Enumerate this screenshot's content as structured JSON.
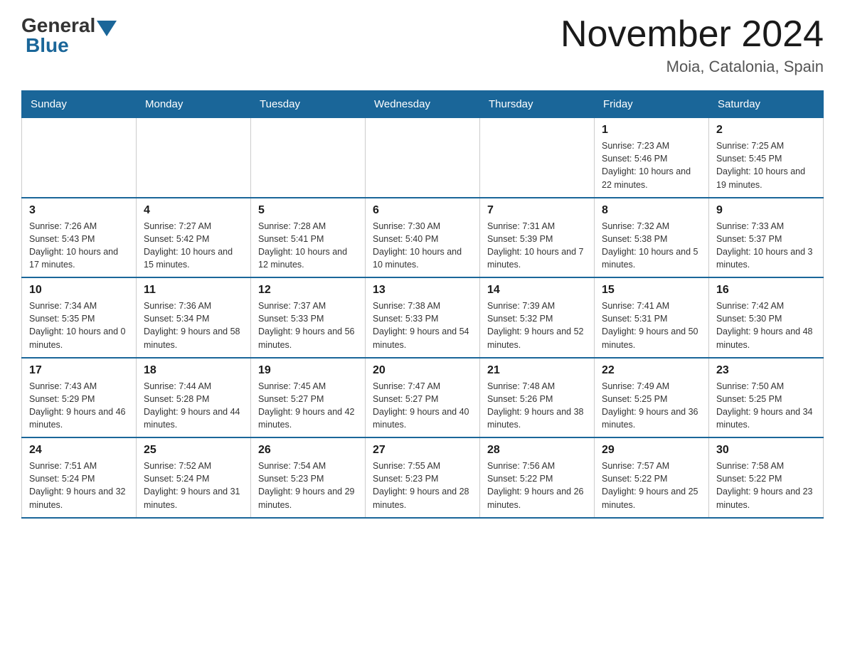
{
  "header": {
    "logo_general": "General",
    "logo_blue": "Blue",
    "month_title": "November 2024",
    "location": "Moia, Catalonia, Spain"
  },
  "days_of_week": [
    "Sunday",
    "Monday",
    "Tuesday",
    "Wednesday",
    "Thursday",
    "Friday",
    "Saturday"
  ],
  "weeks": [
    [
      {
        "day": "",
        "info": ""
      },
      {
        "day": "",
        "info": ""
      },
      {
        "day": "",
        "info": ""
      },
      {
        "day": "",
        "info": ""
      },
      {
        "day": "",
        "info": ""
      },
      {
        "day": "1",
        "info": "Sunrise: 7:23 AM\nSunset: 5:46 PM\nDaylight: 10 hours and 22 minutes."
      },
      {
        "day": "2",
        "info": "Sunrise: 7:25 AM\nSunset: 5:45 PM\nDaylight: 10 hours and 19 minutes."
      }
    ],
    [
      {
        "day": "3",
        "info": "Sunrise: 7:26 AM\nSunset: 5:43 PM\nDaylight: 10 hours and 17 minutes."
      },
      {
        "day": "4",
        "info": "Sunrise: 7:27 AM\nSunset: 5:42 PM\nDaylight: 10 hours and 15 minutes."
      },
      {
        "day": "5",
        "info": "Sunrise: 7:28 AM\nSunset: 5:41 PM\nDaylight: 10 hours and 12 minutes."
      },
      {
        "day": "6",
        "info": "Sunrise: 7:30 AM\nSunset: 5:40 PM\nDaylight: 10 hours and 10 minutes."
      },
      {
        "day": "7",
        "info": "Sunrise: 7:31 AM\nSunset: 5:39 PM\nDaylight: 10 hours and 7 minutes."
      },
      {
        "day": "8",
        "info": "Sunrise: 7:32 AM\nSunset: 5:38 PM\nDaylight: 10 hours and 5 minutes."
      },
      {
        "day": "9",
        "info": "Sunrise: 7:33 AM\nSunset: 5:37 PM\nDaylight: 10 hours and 3 minutes."
      }
    ],
    [
      {
        "day": "10",
        "info": "Sunrise: 7:34 AM\nSunset: 5:35 PM\nDaylight: 10 hours and 0 minutes."
      },
      {
        "day": "11",
        "info": "Sunrise: 7:36 AM\nSunset: 5:34 PM\nDaylight: 9 hours and 58 minutes."
      },
      {
        "day": "12",
        "info": "Sunrise: 7:37 AM\nSunset: 5:33 PM\nDaylight: 9 hours and 56 minutes."
      },
      {
        "day": "13",
        "info": "Sunrise: 7:38 AM\nSunset: 5:33 PM\nDaylight: 9 hours and 54 minutes."
      },
      {
        "day": "14",
        "info": "Sunrise: 7:39 AM\nSunset: 5:32 PM\nDaylight: 9 hours and 52 minutes."
      },
      {
        "day": "15",
        "info": "Sunrise: 7:41 AM\nSunset: 5:31 PM\nDaylight: 9 hours and 50 minutes."
      },
      {
        "day": "16",
        "info": "Sunrise: 7:42 AM\nSunset: 5:30 PM\nDaylight: 9 hours and 48 minutes."
      }
    ],
    [
      {
        "day": "17",
        "info": "Sunrise: 7:43 AM\nSunset: 5:29 PM\nDaylight: 9 hours and 46 minutes."
      },
      {
        "day": "18",
        "info": "Sunrise: 7:44 AM\nSunset: 5:28 PM\nDaylight: 9 hours and 44 minutes."
      },
      {
        "day": "19",
        "info": "Sunrise: 7:45 AM\nSunset: 5:27 PM\nDaylight: 9 hours and 42 minutes."
      },
      {
        "day": "20",
        "info": "Sunrise: 7:47 AM\nSunset: 5:27 PM\nDaylight: 9 hours and 40 minutes."
      },
      {
        "day": "21",
        "info": "Sunrise: 7:48 AM\nSunset: 5:26 PM\nDaylight: 9 hours and 38 minutes."
      },
      {
        "day": "22",
        "info": "Sunrise: 7:49 AM\nSunset: 5:25 PM\nDaylight: 9 hours and 36 minutes."
      },
      {
        "day": "23",
        "info": "Sunrise: 7:50 AM\nSunset: 5:25 PM\nDaylight: 9 hours and 34 minutes."
      }
    ],
    [
      {
        "day": "24",
        "info": "Sunrise: 7:51 AM\nSunset: 5:24 PM\nDaylight: 9 hours and 32 minutes."
      },
      {
        "day": "25",
        "info": "Sunrise: 7:52 AM\nSunset: 5:24 PM\nDaylight: 9 hours and 31 minutes."
      },
      {
        "day": "26",
        "info": "Sunrise: 7:54 AM\nSunset: 5:23 PM\nDaylight: 9 hours and 29 minutes."
      },
      {
        "day": "27",
        "info": "Sunrise: 7:55 AM\nSunset: 5:23 PM\nDaylight: 9 hours and 28 minutes."
      },
      {
        "day": "28",
        "info": "Sunrise: 7:56 AM\nSunset: 5:22 PM\nDaylight: 9 hours and 26 minutes."
      },
      {
        "day": "29",
        "info": "Sunrise: 7:57 AM\nSunset: 5:22 PM\nDaylight: 9 hours and 25 minutes."
      },
      {
        "day": "30",
        "info": "Sunrise: 7:58 AM\nSunset: 5:22 PM\nDaylight: 9 hours and 23 minutes."
      }
    ]
  ]
}
